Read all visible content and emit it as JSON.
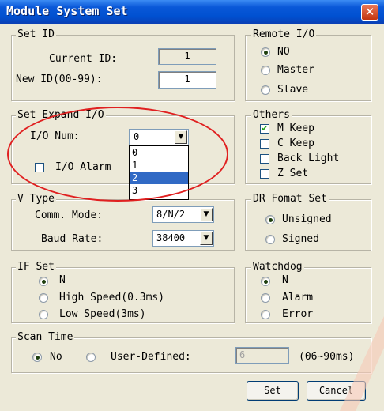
{
  "window": {
    "title": "Module System Set",
    "close_glyph": "✕"
  },
  "set_id": {
    "legend": "Set ID",
    "current_label": "Current ID:",
    "current_value": "1",
    "new_label": "New ID(00-99):",
    "new_value": "1"
  },
  "remote_io": {
    "legend": "Remote I/O",
    "options": [
      "NO",
      "Master",
      "Slave"
    ],
    "selected": "NO"
  },
  "expand_io": {
    "legend": "Set Expand I/O",
    "num_label": "I/O Num:",
    "num_value": "0",
    "dropdown_options": [
      "0",
      "1",
      "2",
      "3"
    ],
    "highlighted_option": "2",
    "alarm_label": "I/O Alarm"
  },
  "others": {
    "legend": "Others",
    "items": [
      {
        "label": "M Keep",
        "checked": true
      },
      {
        "label": "C Keep",
        "checked": false
      },
      {
        "label": "Back Light",
        "checked": false
      },
      {
        "label": "Z Set",
        "checked": false
      }
    ]
  },
  "v_type": {
    "legend": "V Type",
    "comm_label": "Comm. Mode:",
    "comm_value": "8/N/2",
    "baud_label": "Baud Rate:",
    "baud_value": "38400"
  },
  "dr_format": {
    "legend": "DR Fomat Set",
    "options": [
      "Unsigned",
      "Signed"
    ],
    "selected": "Unsigned"
  },
  "if_set": {
    "legend": "IF Set",
    "options": [
      "N",
      "High Speed(0.3ms)",
      "Low Speed(3ms)"
    ],
    "selected": "N"
  },
  "watchdog": {
    "legend": "Watchdog",
    "options": [
      "N",
      "Alarm",
      "Error"
    ],
    "selected": "N"
  },
  "scan_time": {
    "legend": "Scan Time",
    "no_label": "No",
    "user_label": "User-Defined:",
    "user_value": "6",
    "range_hint": "(06~90ms)",
    "selected": "No"
  },
  "buttons": {
    "set": "Set",
    "cancel": "Cancel"
  },
  "icons": {
    "dropdown": "▼",
    "checkmark": "✔"
  },
  "colors": {
    "title_bar": "#0A58D8",
    "close": "#C2350F",
    "highlight": "#316AC5",
    "annotation": "#E02020"
  }
}
